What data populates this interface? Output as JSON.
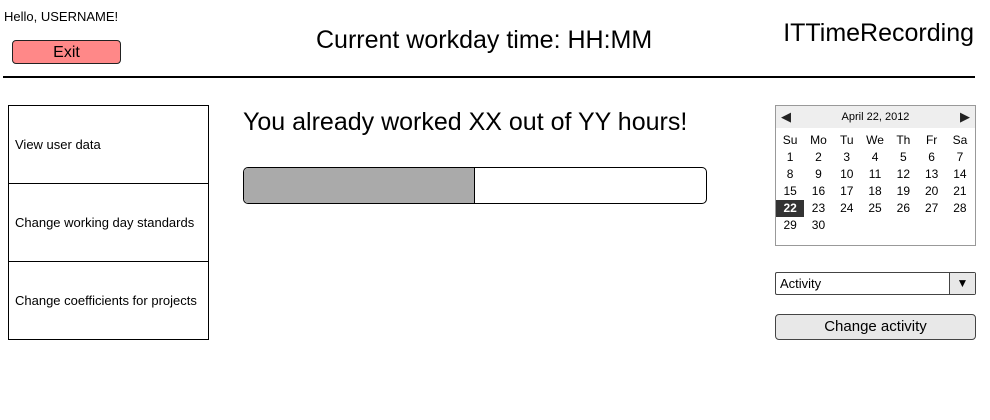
{
  "header": {
    "greeting": "Hello, USERNAME!",
    "exit_label": "Exit",
    "workday_time": "Current workday time: HH:MM",
    "app_title": "ITTimeRecording"
  },
  "menu": {
    "items": [
      {
        "label": "View user data"
      },
      {
        "label": "Change working day standards"
      },
      {
        "label": "Change coefficients for projects"
      }
    ]
  },
  "main": {
    "worked_text": "You already worked XX out of YY hours!",
    "progress_fraction": 0.5
  },
  "calendar": {
    "month_label": "April 22, 2012",
    "prev_icon": "◀",
    "next_icon": "▶",
    "weekdays": [
      "Su",
      "Mo",
      "Tu",
      "We",
      "Th",
      "Fr",
      "Sa"
    ],
    "days": [
      "1",
      "2",
      "3",
      "4",
      "5",
      "6",
      "7",
      "8",
      "9",
      "10",
      "11",
      "12",
      "13",
      "14",
      "15",
      "16",
      "17",
      "18",
      "19",
      "20",
      "21",
      "22",
      "23",
      "24",
      "25",
      "26",
      "27",
      "28",
      "29",
      "30"
    ],
    "selected_day": "22"
  },
  "activity": {
    "selected": "Activity",
    "arrow_icon": "▼",
    "change_label": "Change activity"
  }
}
